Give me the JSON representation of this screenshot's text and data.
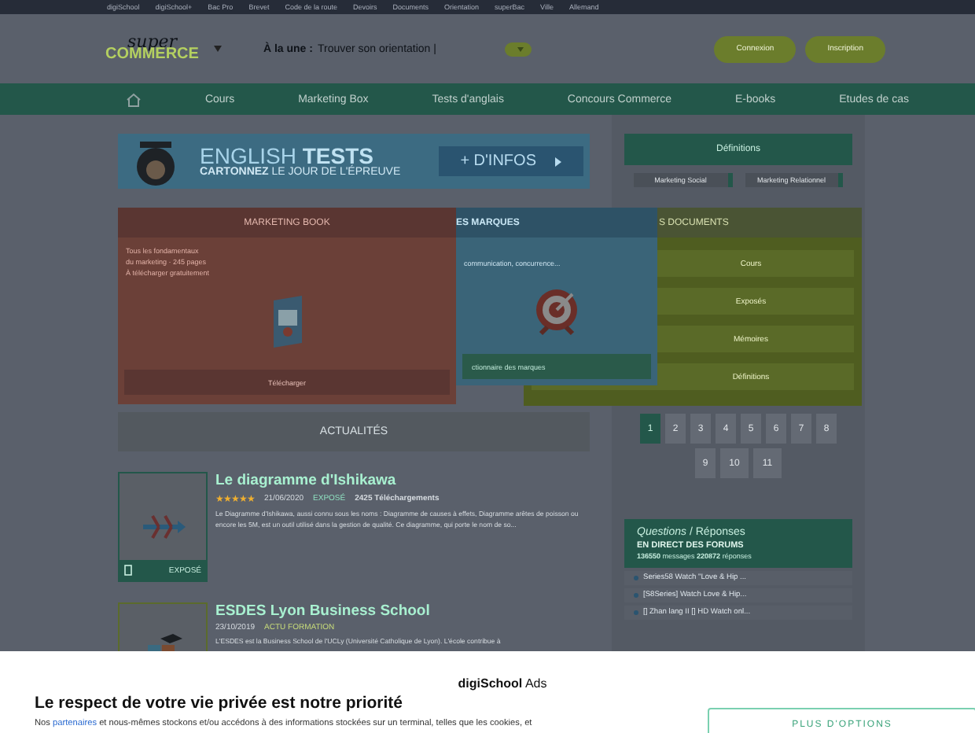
{
  "top_links": [
    "digiSchool",
    "digiSchool+",
    "Bac Pro",
    "Brevet",
    "Code de la route",
    "Devoirs",
    "Documents",
    "Orientation",
    "superBac",
    "Ville",
    "Allemand"
  ],
  "header": {
    "logo_top": "super",
    "logo_bottom": "COMMERCE",
    "headline_label": "À la une :",
    "headline": "Trouver son orientation |",
    "buttons": [
      "Connexion",
      "Inscription"
    ]
  },
  "nav": [
    "Cours",
    "Marketing Box",
    "Tests d'anglais",
    "Concours Commerce",
    "E-books",
    "Etudes de cas"
  ],
  "banner": {
    "title_light": "ENGLISH",
    "title_bold": "TESTS",
    "subtitle_bold": "CARTONNEZ",
    "subtitle": "LE JOUR DE L'ÉPREUVE",
    "button": "+ D'INFOS"
  },
  "menus": [
    {
      "kind": "book",
      "title": "MARKETING BOOK",
      "lines": [
        "Tous les fondamentaux",
        "du marketing · 245 pages",
        "À télécharger gratuitement"
      ],
      "button": "Télécharger"
    },
    {
      "kind": "brands",
      "title": "ES MARQUES",
      "lines": [
        "communication, concurrence..."
      ],
      "button": "ctionnaire des marques"
    },
    {
      "kind": "docs",
      "title": "S DOCUMENTS",
      "links": [
        "Cours",
        "Exposés",
        "Mémoires",
        "Définitions"
      ]
    }
  ],
  "definitions": {
    "title": "Définitions",
    "tags": [
      "Marketing Social",
      "Marketing Relationnel"
    ]
  },
  "news": {
    "title": "ACTUALITÉS",
    "articles": [
      {
        "kind": "expose",
        "title": "Le diagramme d'Ishikawa",
        "stars": 5,
        "date": "21/06/2020",
        "category": "EXPOSÉ",
        "downloads": "2425 Téléchargements",
        "badge": "EXPOSÉ",
        "text": "Le Diagramme d'Ishikawa, aussi connu sous les noms : Diagramme de causes à effets, Diagramme arêtes de poisson ou encore les 5M, est un outil utilisé dans la gestion de qualité. Ce diagramme, qui porte le nom de so..."
      },
      {
        "kind": "school",
        "title": "ESDES Lyon Business School",
        "date": "23/10/2019",
        "category": "ACTU FORMATION",
        "text": "L'ESDES est la Business School de l'UCLy (Université Catholique de Lyon). L'école contribue à"
      }
    ]
  },
  "pagination": [
    {
      "label": "1",
      "selected": true
    },
    {
      "label": "2",
      "selected": false
    },
    {
      "label": "3",
      "selected": false
    },
    {
      "label": "4",
      "selected": false
    },
    {
      "label": "5",
      "selected": false
    },
    {
      "label": "6",
      "selected": false
    },
    {
      "label": "7",
      "selected": false
    },
    {
      "label": "8",
      "selected": false
    },
    {
      "label": "9",
      "selected": false
    },
    {
      "label": "10",
      "selected": false
    },
    {
      "label": "11",
      "selected": false
    }
  ],
  "forum": {
    "title_italic": "Questions",
    "title": "/ Réponses",
    "subtitle": "EN DIRECT DES FORUMS",
    "messages": "136550",
    "messages_label": "messages",
    "replies": "220872",
    "replies_label": "réponses",
    "topics": [
      "Series58 Watch \"Love & Hip ...",
      "[S8Series] Watch Love & Hip...",
      "[] Zhan lang II [] HD Watch onl..."
    ]
  },
  "consent": {
    "brand": "digiSchool",
    "brand_suffix": "Ads",
    "title": "Le respect de votre vie privée est notre priorité",
    "text_before": "Nos",
    "link": "partenaires",
    "text_after": "et nous-mêmes stockons et/ou accédons à des informations stockées sur un terminal, telles que les cookies, et",
    "button": "PLUS D'OPTIONS"
  }
}
